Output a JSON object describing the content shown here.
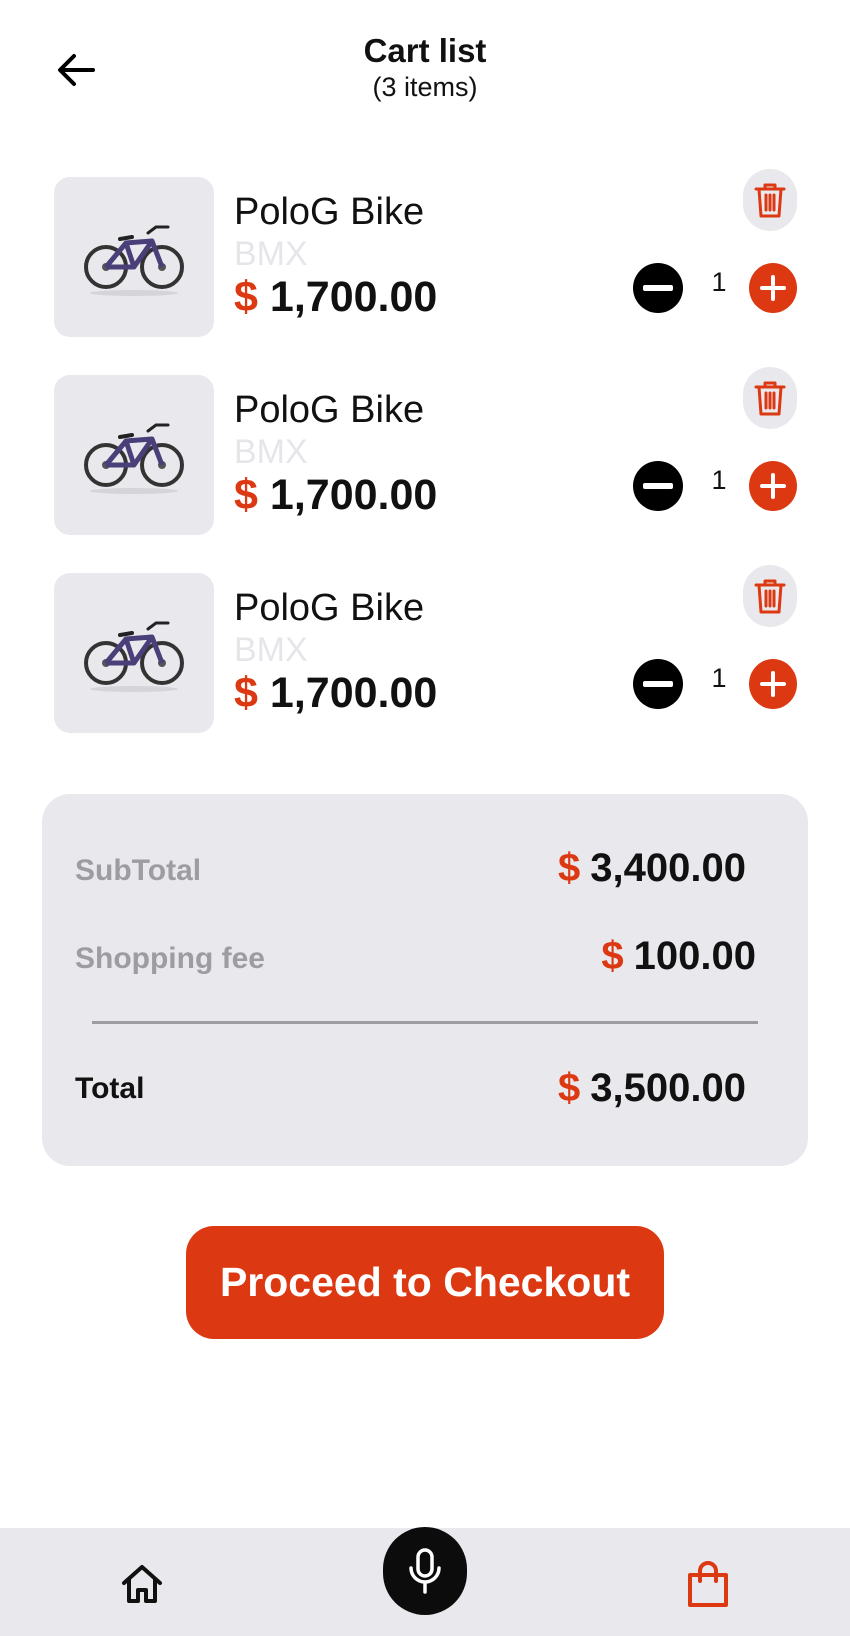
{
  "header": {
    "title": "Cart list",
    "subtitle": "(3 items)",
    "back_icon": "arrow-left-icon"
  },
  "items": [
    {
      "name": "PoloG Bike",
      "category": "BMX",
      "currency": "$",
      "price": "1,700.00",
      "quantity": "1",
      "image": "mountain-bike-image"
    },
    {
      "name": "PoloG Bike",
      "category": "BMX",
      "currency": "$",
      "price": "1,700.00",
      "quantity": "1",
      "image": "mountain-bike-image"
    },
    {
      "name": "PoloG Bike",
      "category": "BMX",
      "currency": "$",
      "price": "1,700.00",
      "quantity": "1",
      "image": "mountain-bike-image"
    }
  ],
  "summary": {
    "subtotal_label": "SubTotal",
    "subtotal_currency": "$",
    "subtotal_value": "3,400.00",
    "fee_label": "Shopping fee",
    "fee_currency": "$",
    "fee_value": "100.00",
    "total_label": "Total",
    "total_currency": "$",
    "total_value": "3,500.00"
  },
  "checkout": {
    "label": "Proceed to Checkout"
  },
  "bottom_nav": {
    "items": [
      "home-icon",
      "microphone-icon",
      "shopping-bag-icon"
    ]
  },
  "colors": {
    "accent": "#dc3913",
    "surface": "#e9e8ec",
    "muted_text": "#9d9ca1",
    "category_text": "#e6e5ea",
    "dark": "#000000"
  }
}
